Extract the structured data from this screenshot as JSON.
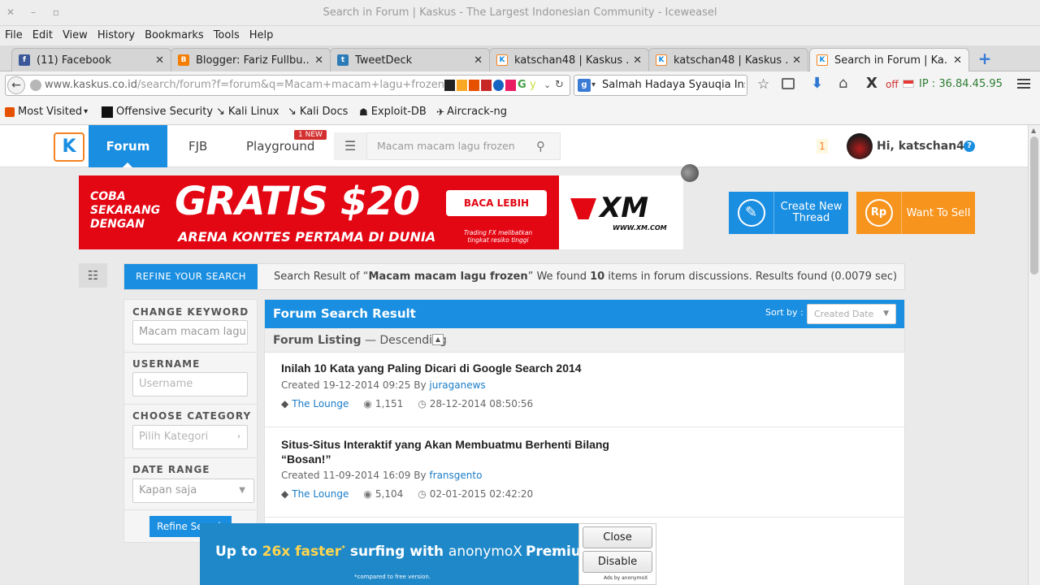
{
  "window": {
    "title": "Search in Forum | Kaskus - The Largest Indonesian Community - Iceweasel"
  },
  "menu": [
    "File",
    "Edit",
    "View",
    "History",
    "Bookmarks",
    "Tools",
    "Help"
  ],
  "tabs": [
    {
      "label": "(11) Facebook",
      "icon": "facebook-icon",
      "color": "#3b5998"
    },
    {
      "label": "Blogger: Fariz Fullbu...",
      "icon": "blogger-icon",
      "color": "#f57d00"
    },
    {
      "label": "TweetDeck",
      "icon": "tweetdeck-icon",
      "color": "#2b7bb9"
    },
    {
      "label": "katschan48 | Kaskus ...",
      "icon": "kaskus-icon",
      "color": "#f58220"
    },
    {
      "label": "katschan48 | Kaskus ...",
      "icon": "kaskus-icon",
      "color": "#f58220"
    },
    {
      "label": "Search in Forum | Ka...",
      "icon": "kaskus-icon",
      "color": "#f58220"
    }
  ],
  "nav": {
    "url_host": "www.kaskus.co.id",
    "url_path": "/search/forum?f=forum&q=Macam+macam+lagu+frozen",
    "search_value": "Salmah Hadaya Syauqia Ins",
    "addon_off": "off",
    "ip_text": "IP : 36.84.45.95"
  },
  "bookmarks": [
    {
      "label": "Most Visited",
      "icon": "bookmark-folder-icon"
    },
    {
      "label": "Offensive Security",
      "icon": "offsec-icon"
    },
    {
      "label": "Kali Linux",
      "icon": "kali-icon"
    },
    {
      "label": "Kali Docs",
      "icon": "kali-icon"
    },
    {
      "label": "Exploit-DB",
      "icon": "exploitdb-icon"
    },
    {
      "label": "Aircrack-ng",
      "icon": "aircrack-icon"
    }
  ],
  "header": {
    "nav_forum": "Forum",
    "nav_fjb": "FJB",
    "nav_playground": "Playground",
    "new_badge": "1 NEW",
    "search_placeholder": "Macam macam lagu frozen",
    "notif_count": "1",
    "greeting": "Hi, katschan48"
  },
  "banner": {
    "left_text": "COBA SEKARANG DENGAN",
    "big_text": "GRATIS $20",
    "sub_text": "ARENA KONTES PERTAMA DI DUNIA",
    "cta": "BACA LEBIH LANJUT",
    "disclaimer": "Trading FX melibatkan tingkat resiko tinggi",
    "brand": "XM",
    "brand_url": "WWW.XM.COM"
  },
  "actions": {
    "create_thread": "Create New Thread",
    "want_to_sell": "Want To Sell"
  },
  "refine": {
    "tab_label": "REFINE YOUR SEARCH",
    "summary_prefix": "Search Result of “",
    "query": "Macam macam lagu frozen",
    "summary_mid": "” We found ",
    "count": "10",
    "summary_suffix": " items in forum discussions. Results found (0.0079 sec)"
  },
  "sidebar": {
    "keyword_label": "CHANGE KEYWORD",
    "keyword_value": "Macam macam lagu",
    "username_label": "USERNAME",
    "username_placeholder": "Username",
    "category_label": "CHOOSE CATEGORY",
    "category_placeholder": "Pilih Kategori",
    "date_label": "DATE RANGE",
    "date_value": "Kapan saja",
    "refine_button": "Refine Search"
  },
  "results": {
    "header": "Forum Search Result",
    "sort_label": "Sort by :",
    "sort_value": "Created Date",
    "listing_label": "Forum Listing",
    "listing_order": "— Descending",
    "items": [
      {
        "title": "Inilah 10 Kata yang Paling Dicari di Google Search 2014",
        "title_line2": "",
        "created": "Created 19-12-2014 09:25 By ",
        "author": "juraganews",
        "category": "The Lounge",
        "views": "1,151",
        "last": "28-12-2014 08:50:56"
      },
      {
        "title": "Situs-Situs Interaktif yang Akan Membuatmu Berhenti Bilang",
        "title_line2": "“Bosan!”",
        "created": "Created 11-09-2014 16:09 By ",
        "author": "fransgento",
        "category": "The Lounge",
        "views": "5,104",
        "last": "02-01-2015 02:42:20"
      }
    ]
  },
  "ad": {
    "headline_prefix": "Up to ",
    "headline_speed": "26x faster",
    "headline_star": "*",
    "headline_suffix": " surfing with",
    "brand": "anonymoX",
    "premium": "Premium",
    "footnote": "*compared to free version.",
    "close": "Close",
    "disable": "Disable",
    "ads_by": "Ads by anonymoX"
  }
}
